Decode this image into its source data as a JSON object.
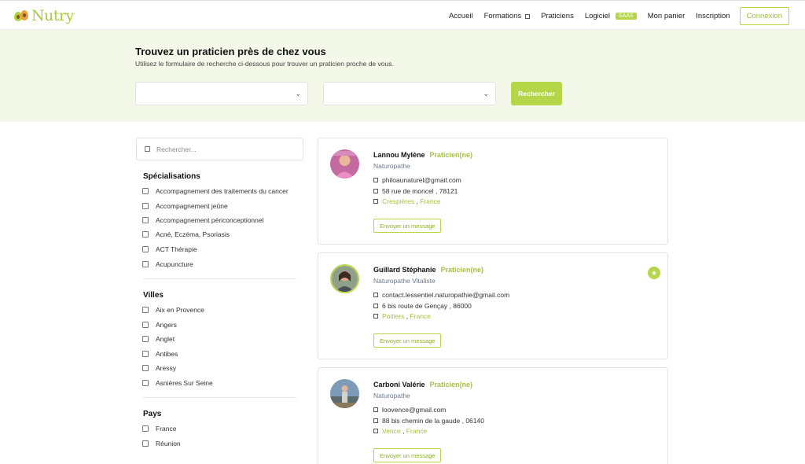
{
  "nav": {
    "logo": "Nutry",
    "links": [
      "Accueil",
      "Formations",
      "Praticiens",
      "Logiciel",
      "Mon panier",
      "Inscription"
    ],
    "saas_badge": "SAAS",
    "login": "Connexion"
  },
  "hero": {
    "title": "Trouvez un praticien près de chez vous",
    "subtitle": "Utilisez le formulaire de recherche ci-dessous pour trouver un praticien proche de vous.",
    "select1_value": "",
    "select2_value": "",
    "search_button": "Rechercher"
  },
  "sidebar": {
    "search_placeholder": "Rechercher...",
    "specialisations_title": "Spécialisations",
    "specialisations": [
      "Accompagnement des traitements du cancer",
      "Accompagnement jeûne",
      "Accompagnement périconceptionnel",
      "Acné, Eczéma, Psoriasis",
      "ACT Thérapie",
      "Acupuncture"
    ],
    "villes_title": "Villes",
    "villes": [
      "Aix en Provence",
      "Angers",
      "Anglet",
      "Antibes",
      "Aressy",
      "Asnières Sur Seine"
    ],
    "pays_title": "Pays",
    "pays": [
      "France",
      "Réunion"
    ]
  },
  "practitioners": [
    {
      "name": "Lannou Mylène",
      "badge": "Praticien(ne)",
      "job": "Naturopathe",
      "email": "philoaunaturel@gmail.com",
      "address": "58 rue de moncel , 78121",
      "city": "Crespières",
      "country": "France",
      "button": "Envoyer un message",
      "featured": false
    },
    {
      "name": "Guillard Stéphanie",
      "badge": "Praticien(ne)",
      "job": "Naturopathe Vitaliste",
      "email": "contact.lessentiel.naturopathie@gmail.com",
      "address": "6 bis route de Gençay , 86000",
      "city": "Poitiers",
      "country": "France",
      "button": "Envoyer un message",
      "featured": true,
      "featured_icon": "star-icon"
    },
    {
      "name": "Carboni Valérie",
      "badge": "Praticien(ne)",
      "job": "Naturopathe",
      "email": "loovence@gmail.com",
      "address": "88 bis chemin de la gaude , 06140",
      "city": "Vence",
      "country": "France",
      "button": "Envoyer un message",
      "featured": false
    }
  ],
  "colors": {
    "accent": "#b6d64a",
    "hero_bg": "#f3f8e9"
  }
}
